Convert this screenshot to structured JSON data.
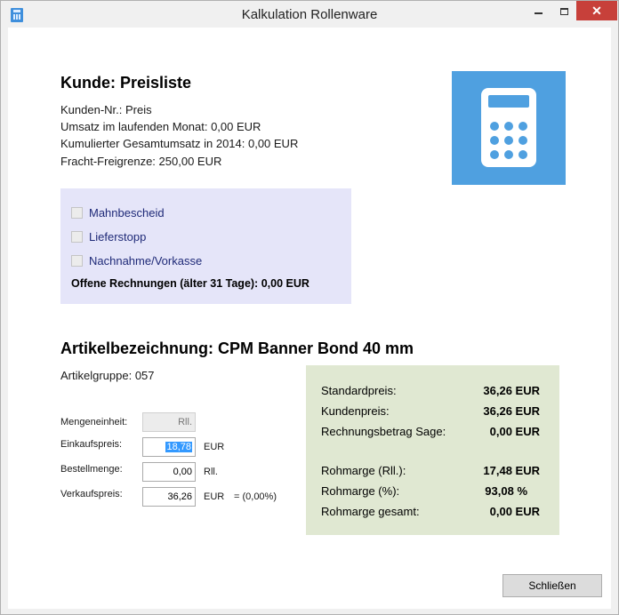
{
  "window": {
    "title": "Kalkulation Rollenware",
    "close_glyph": "✕"
  },
  "customer": {
    "heading": "Kunde: Preisliste",
    "lines": [
      "Kunden-Nr.: Preis",
      "Umsatz im laufenden Monat: 0,00 EUR",
      "Kumulierter Gesamtumsatz in 2014: 0,00 EUR",
      "Fracht-Freigrenze: 250,00 EUR"
    ]
  },
  "flags": {
    "items": [
      {
        "label": "Mahnbescheid",
        "checked": false
      },
      {
        "label": "Lieferstopp",
        "checked": false
      },
      {
        "label": "Nachnahme/Vorkasse",
        "checked": false
      }
    ],
    "open_invoices": "Offene Rechnungen (älter 31 Tage): 0,00 EUR"
  },
  "article": {
    "heading": "Artikelbezeichnung: CPM Banner Bond 40 mm",
    "group": "Artikelgruppe: 057",
    "unit_label": "Mengeneinheit:",
    "unit_value": "Rll.",
    "purchase_label": "Einkaufspreis:",
    "purchase_value": "18,78",
    "purchase_unit": "EUR",
    "order_qty_label": "Bestellmenge:",
    "order_qty_value": "0,00",
    "order_qty_unit": "Rll.",
    "sale_label": "Verkaufspreis:",
    "sale_value": "36,26",
    "sale_unit": "EUR",
    "sale_pct": "= (0,00%)"
  },
  "prices": {
    "rows": [
      {
        "label": "Standardpreis:",
        "value": "36,26 EUR"
      },
      {
        "label": "Kundenpreis:",
        "value": "36,26 EUR"
      },
      {
        "label": "Rechnungsbetrag Sage:",
        "value": "0,00 EUR"
      },
      {
        "label": "Rohmarge (Rll.):",
        "value": "17,48 EUR"
      },
      {
        "label": "Rohmarge (%):",
        "value": "93,08 %"
      },
      {
        "label": "Rohmarge gesamt:",
        "value": "0,00 EUR"
      }
    ]
  },
  "footer": {
    "close_label": "Schließen"
  },
  "colors": {
    "calc_tile": "#4fa0e0",
    "status_box": "#e5e5f9",
    "price_box": "#e0e8d2",
    "window_close": "#c7403a"
  }
}
